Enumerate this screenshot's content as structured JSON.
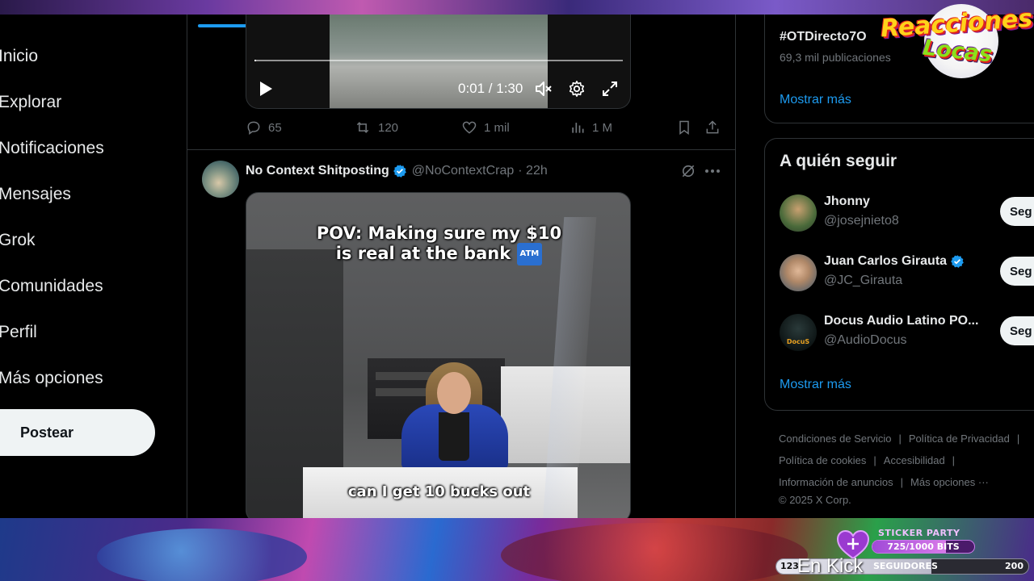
{
  "nav": {
    "items": [
      {
        "label": "Inicio"
      },
      {
        "label": "Explorar"
      },
      {
        "label": "Notificaciones"
      },
      {
        "label": "Mensajes"
      },
      {
        "label": "Grok"
      },
      {
        "label": "Comunidades"
      },
      {
        "label": "Perfil"
      },
      {
        "label": "Más opciones"
      }
    ],
    "post_button": "Postear"
  },
  "tweet1": {
    "video": {
      "time": "0:01 / 1:30",
      "progress": 0.005
    },
    "stats": {
      "replies": "65",
      "reposts": "120",
      "likes": "1 mil",
      "views": "1 M"
    }
  },
  "tweet2": {
    "name": "No Context Shitposting",
    "handle": "@NoContextCrap",
    "time": "· 22h",
    "video": {
      "caption_top_line1": "POV: Making sure my $10",
      "caption_top_line2": "is real at the bank",
      "atm_badge": "ATM",
      "caption_bottom": "can I get 10 bucks out"
    }
  },
  "trends": {
    "tag": "#OTDirecto7O",
    "count": "69,3 mil publicaciones",
    "show_more": "Mostrar más"
  },
  "who_to_follow": {
    "title": "A quién seguir",
    "users": [
      {
        "name": "Jhonny",
        "handle": "@josejnieto8",
        "verified": false,
        "button": "Seg"
      },
      {
        "name": "Juan Carlos Girauta",
        "handle": "@JC_Girauta",
        "verified": true,
        "button": "Seg"
      },
      {
        "name": "Docus Audio Latino PO...",
        "handle": "@AudioDocus",
        "verified": false,
        "button": "Seg",
        "avatar_text": "DocuS"
      }
    ],
    "show_more": "Mostrar más"
  },
  "footer": {
    "links": [
      "Condiciones de Servicio",
      "Política de Privacidad",
      "Política de cookies",
      "Accesibilidad",
      "Información de anuncios",
      "Más opciones ···"
    ],
    "copyright": "© 2025 X Corp."
  },
  "overlay": {
    "logo_line1": "Reacciones",
    "logo_line2": "Locas",
    "sticker_title": "STICKER PARTY",
    "sticker_progress": "725/1000 BITS",
    "sticker_fraction": 0.725,
    "followers_current": "123",
    "followers_label": "SEGUIDORES",
    "followers_goal": "200",
    "followers_fraction": 0.615,
    "kick_text": "En Kick"
  },
  "colors": {
    "accent": "#1d9bf0",
    "verified": "#1d9bf0",
    "muted": "#71767b"
  }
}
